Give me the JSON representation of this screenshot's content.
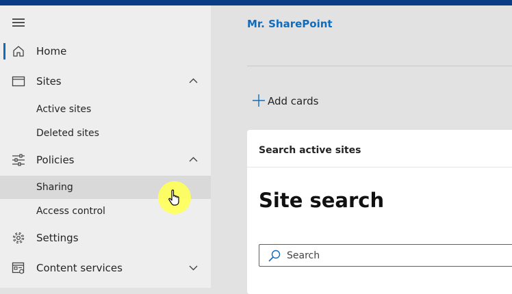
{
  "sidebar": {
    "items": [
      {
        "label": "Home",
        "icon": "home-icon",
        "active": true
      },
      {
        "label": "Sites",
        "icon": "browser-window-icon",
        "expanded": true,
        "children": [
          {
            "label": "Active sites"
          },
          {
            "label": "Deleted sites"
          }
        ]
      },
      {
        "label": "Policies",
        "icon": "sliders-icon",
        "expanded": true,
        "children": [
          {
            "label": "Sharing",
            "selected": true
          },
          {
            "label": "Access control"
          }
        ]
      },
      {
        "label": "Settings",
        "icon": "gear-icon"
      },
      {
        "label": "Content services",
        "icon": "content-services-icon",
        "expanded": false
      }
    ]
  },
  "main": {
    "tenant_name": "Mr. SharePoint",
    "add_cards_label": "Add cards",
    "card": {
      "header": "Search active sites",
      "title": "Site search",
      "search_placeholder": "Search"
    }
  },
  "colors": {
    "accent": "#0f6cbd",
    "topbar": "#0b3d85",
    "cursor_highlight": "#ffff5a"
  }
}
